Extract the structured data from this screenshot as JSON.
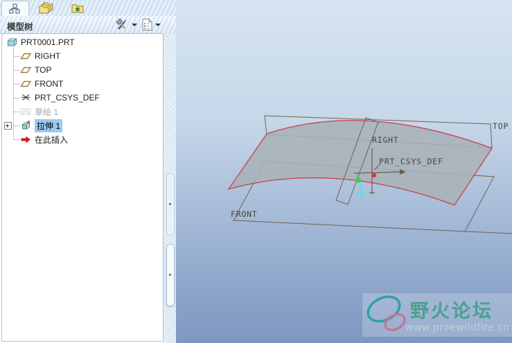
{
  "navigator": {
    "title": "模型树",
    "tabs": [
      {
        "name": "model-tree",
        "icon": "model-tree-icon",
        "active": true
      },
      {
        "name": "folder-browser",
        "icon": "folders-icon",
        "active": false
      },
      {
        "name": "favorites",
        "icon": "folder-star-icon",
        "active": false
      }
    ],
    "toolbar": [
      {
        "name": "tree-settings",
        "icon": "tools-icon",
        "has_dropdown": true
      },
      {
        "name": "tree-filters",
        "icon": "checklist-icon",
        "has_dropdown": true
      }
    ]
  },
  "model_tree": {
    "root": {
      "label": "PRT0001.PRT",
      "icon": "part-icon"
    },
    "items": [
      {
        "label": "RIGHT",
        "icon": "datum-plane-icon",
        "state": "normal"
      },
      {
        "label": "TOP",
        "icon": "datum-plane-icon",
        "state": "normal"
      },
      {
        "label": "FRONT",
        "icon": "datum-plane-icon",
        "state": "normal"
      },
      {
        "label": "PRT_CSYS_DEF",
        "icon": "csys-icon",
        "state": "normal"
      },
      {
        "label": "草绘 1",
        "icon": "sketch-icon",
        "state": "suppressed"
      },
      {
        "label": "拉伸 1",
        "icon": "extrude-icon",
        "state": "selected",
        "expandable": true
      },
      {
        "label": "在此插入",
        "icon": "insert-arrow-icon",
        "state": "normal"
      }
    ]
  },
  "viewport": {
    "datum_labels": {
      "top": "TOP",
      "right": "RIGHT",
      "front": "FRONT",
      "csys": "PRT_CSYS_DEF"
    },
    "colors": {
      "background_top": "#d7e4f1",
      "background_bottom": "#7d97c0",
      "surface_fill": "#a9b2b8",
      "edge": "#c74754",
      "datum_line": "#70624c",
      "csys_x_dot": "#e03030",
      "csys_origin_dot": "#3ecf4e",
      "csys_arrow": "#5ae0f2"
    }
  },
  "watermark": {
    "title": "野火论坛",
    "url": "www.proewildfire.cn"
  }
}
